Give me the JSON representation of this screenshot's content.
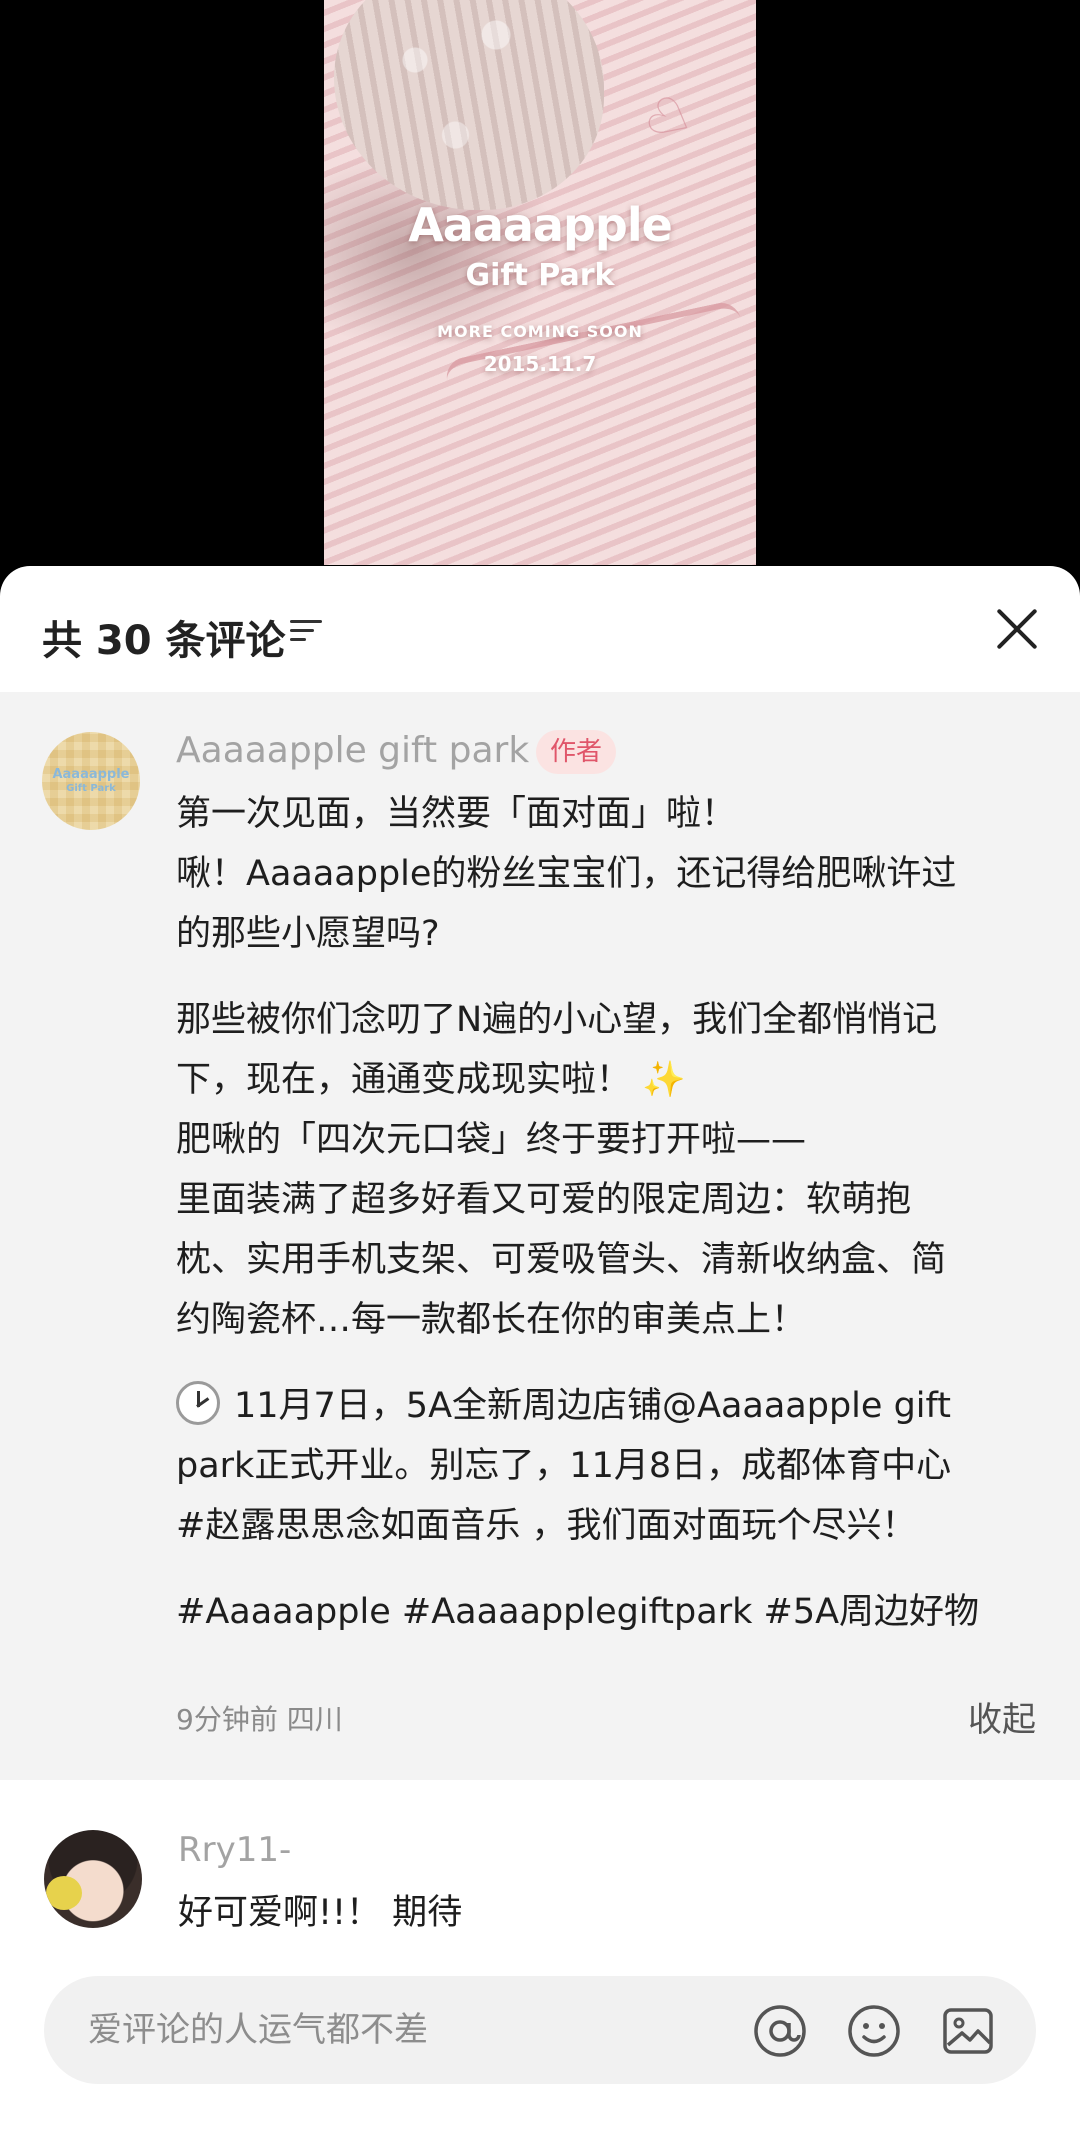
{
  "video": {
    "title": "Aaaaapple",
    "subtitle": "Gift Park",
    "tagline": "MORE COMING SOON",
    "date": "2015.11.7"
  },
  "header": {
    "count_label": "共 30 条评论",
    "icons": [
      "sort-icon",
      "close-icon"
    ]
  },
  "author_comment": {
    "name": "Aaaaapple gift park",
    "avatar_text_1": "Aaaaapple",
    "avatar_text_2": "Gift Park",
    "badge": "作者",
    "line1": "第一次见面，当然要「面对面」啦！",
    "line2": "啾！Aaaaapple的粉丝宝宝们，还记得给肥啾许过",
    "line3": "的那些小愿望吗?",
    "line4": "那些被你们念叨了N遍的小心望，我们全都悄悄记",
    "line5a": "下，现在，通通变成现实啦！",
    "sparkle": "✨",
    "line6": "肥啾的「四次元口袋」终于要打开啦——",
    "line7": "里面装满了超多好看又可爱的限定周边：软萌抱",
    "line8": "枕、实用手机支架、可爱吸管头、清新收纳盒、简",
    "line9": "约陶瓷杯…每一款都长在你的审美点上！",
    "line10": "11月7日，5A全新周边店铺@Aaaaapple gift",
    "line11": "park正式开业。别忘了，11月8日，成都体育中心",
    "hashtag_line_tag": "#赵露思思念如面音乐",
    "hashtag_line_rest": " ，我们面对面玩个尽兴！",
    "hashtags": [
      "#Aaaaapple",
      "#Aaaaapplegiftpark",
      "#5A周边好物"
    ],
    "time": "9分钟前",
    "location": "四川",
    "collapse_label": "收起"
  },
  "reply_comment": {
    "name": "Rry11-",
    "text": "好可爱啊!!！ 期待"
  },
  "input": {
    "placeholder": "爱评论的人运气都不差",
    "value": "",
    "icons": [
      "at-icon",
      "emoji-icon",
      "image-icon"
    ]
  },
  "colors": {
    "badge_bg": "#fbe3e2",
    "badge_text": "#e0566a",
    "comment_bg": "#f3f3f3",
    "input_bg": "#f1f1f1"
  }
}
